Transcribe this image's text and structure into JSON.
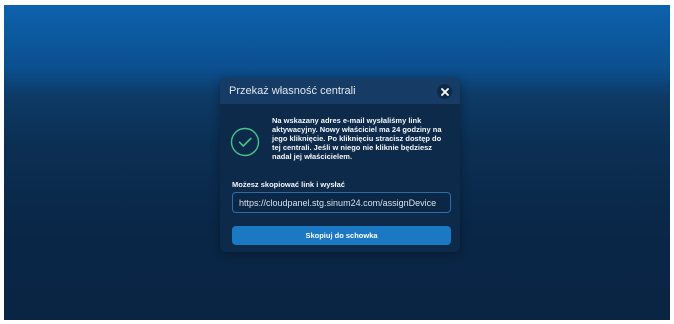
{
  "dialog": {
    "title": "Przekaż własność centrali",
    "close_icon": "close-icon",
    "status_icon": "check-circle-icon",
    "message": "Na wskazany adres e-mail wysłaliśmy link aktywacyjny. Nowy właściciel ma 24 godziny na jego kliknięcie. Po kliknięciu stracisz dostęp do tej centrali. Jeśli w niego nie kliknie będziesz nadal jej właścicielem.",
    "copy_label": "Możesz skopiować link i wysłać",
    "link_value": "https://cloudpanel.stg.sinum24.com/assignDevice",
    "copy_button_label": "Skopiuj do schowka"
  },
  "colors": {
    "background_top": "#0d62ad",
    "background_bottom": "#0a2443",
    "modal_body": "#0e2a4b",
    "modal_header": "#163b64",
    "success_accent": "#44c489",
    "primary_button": "#1b79c3"
  }
}
